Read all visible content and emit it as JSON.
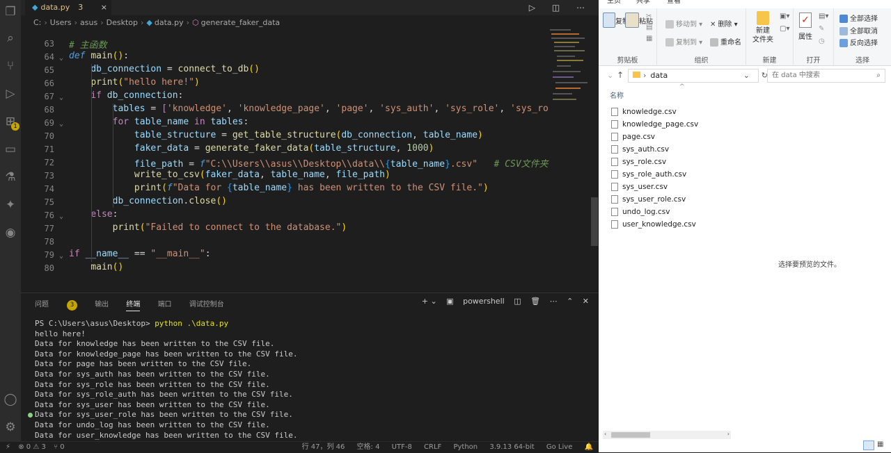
{
  "editor": {
    "tab": {
      "name": "data.py",
      "problem_count": "3",
      "close": "×"
    },
    "actions": "▷ ◫ ⋯",
    "breadcrumb": {
      "drive": "C:",
      "users": "Users",
      "user": "asus",
      "desktop": "Desktop",
      "file": "data.py",
      "symbol": "generate_faker_data"
    },
    "line_numbers": [
      "63",
      "64",
      "65",
      "66",
      "67",
      "68",
      "69",
      "70",
      "71",
      "72",
      "73",
      "74",
      "75",
      "76",
      "77",
      "78",
      "79",
      "80"
    ]
  },
  "panel": {
    "tabs": {
      "problems": "问题",
      "problems_count": "3",
      "output": "输出",
      "terminal": "终端",
      "ports": "端口",
      "debug_console": "调试控制台"
    },
    "shell": "powershell",
    "terminal_lines": [
      "hello here!",
      "Data for knowledge has been written to the CSV file.",
      "Data for knowledge_page has been written to the CSV file.",
      "Data for page has been written to the CSV file.",
      "Data for sys_auth has been written to the CSV file.",
      "Data for sys_role has been written to the CSV file.",
      "Data for sys_role_auth has been written to the CSV file.",
      "Data for sys_user has been written to the CSV file.",
      "Data for sys_user_role has been written to the CSV file.",
      "Data for undo_log has been written to the CSV file.",
      "Data for user_knowledge has been written to the CSV file."
    ],
    "prompt": "PS C:\\Users\\asus\\Desktop> ",
    "command": "python .\\data.py"
  },
  "status": {
    "errors": "⊗ 0 ⚠ 3",
    "ports": "⑂ 0",
    "cursor": "行 47，列 46",
    "spaces": "空格: 4",
    "encoding": "UTF-8",
    "eol": "CRLF",
    "language": "Python",
    "interpreter": "3.9.13 64-bit",
    "golive": "Go Live"
  },
  "explorer": {
    "ribbon_tabs": {
      "home": "主页",
      "share": "共享",
      "view": "查看"
    },
    "groups": {
      "clipboard": "剪贴板",
      "organize": "组织",
      "new": "新建",
      "open": "打开",
      "select": "选择"
    },
    "buttons": {
      "copy": "复制",
      "paste": "粘贴",
      "move_to": "移动到",
      "copy_to": "复制到",
      "delete": "删除",
      "rename": "重命名",
      "new_folder": "新建\n文件夹",
      "properties": "属性",
      "select_all": "全部选择",
      "select_none": "全部取消",
      "invert_select": "反向选择"
    },
    "address": "data",
    "search_placeholder": "在 data 中搜索",
    "column_name": "名称",
    "files": [
      "knowledge.csv",
      "knowledge_page.csv",
      "page.csv",
      "sys_auth.csv",
      "sys_role.csv",
      "sys_role_auth.csv",
      "sys_user.csv",
      "sys_user_role.csv",
      "undo_log.csv",
      "user_knowledge.csv"
    ],
    "preview_text": "选择要预览的文件。"
  },
  "colors": {
    "vscode_bg": "#1e1e1e",
    "keyword": "#569cd6",
    "string": "#ce9178",
    "function": "#dcdcaa",
    "comment": "#6a9955"
  }
}
